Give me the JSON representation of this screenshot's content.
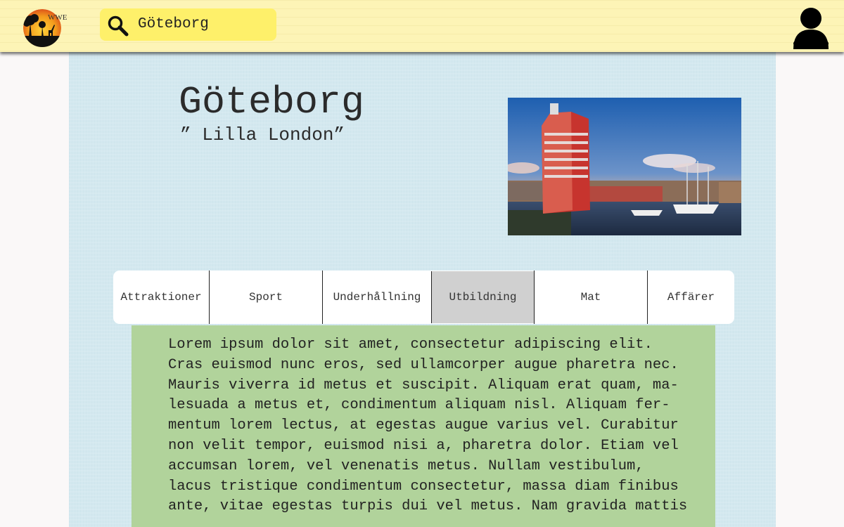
{
  "header": {
    "logo_text": "WWE",
    "search": {
      "value": "Göteborg",
      "placeholder": ""
    }
  },
  "city": {
    "title": "Göteborg",
    "subtitle": "” Lilla London”"
  },
  "tabs": [
    {
      "label": "Attraktioner",
      "active": false
    },
    {
      "label": "Sport",
      "active": false
    },
    {
      "label": "Underhållning",
      "active": false
    },
    {
      "label": "Utbildning",
      "active": true
    },
    {
      "label": "Mat",
      "active": false
    },
    {
      "label": "Affärer",
      "active": false
    }
  ],
  "content": {
    "text": "Lorem ipsum dolor sit amet, consectetur adipiscing elit.\nCras euismod nunc eros, sed ullamcorper augue pharetra nec.\nMauris viverra id metus et suscipit. Aliquam erat quam, ma-\nlesuada a metus et, condimentum aliquam nisl. Aliquam fer-\nmentum lorem lectus, at egestas augue varius vel. Curabitur\nnon velit tempor, euismod nisi a, pharetra dolor. Etiam vel\naccumsan lorem, vel venenatis metus. Nullam vestibulum,\nlacus tristique condimentum consectetur, massa diam finibus\nante, vitae egestas turpis dui vel metus. Nam gravida mattis"
  },
  "icons": {
    "search": "search-icon",
    "user": "user-icon",
    "logo": "logo-icon"
  },
  "colors": {
    "header_bg": "#fdf4b6",
    "search_bg": "#fef06a",
    "panel_bg": "#d3e8ef",
    "content_bg": "#b1d39b",
    "active_tab_bg": "#d0d0d0"
  }
}
